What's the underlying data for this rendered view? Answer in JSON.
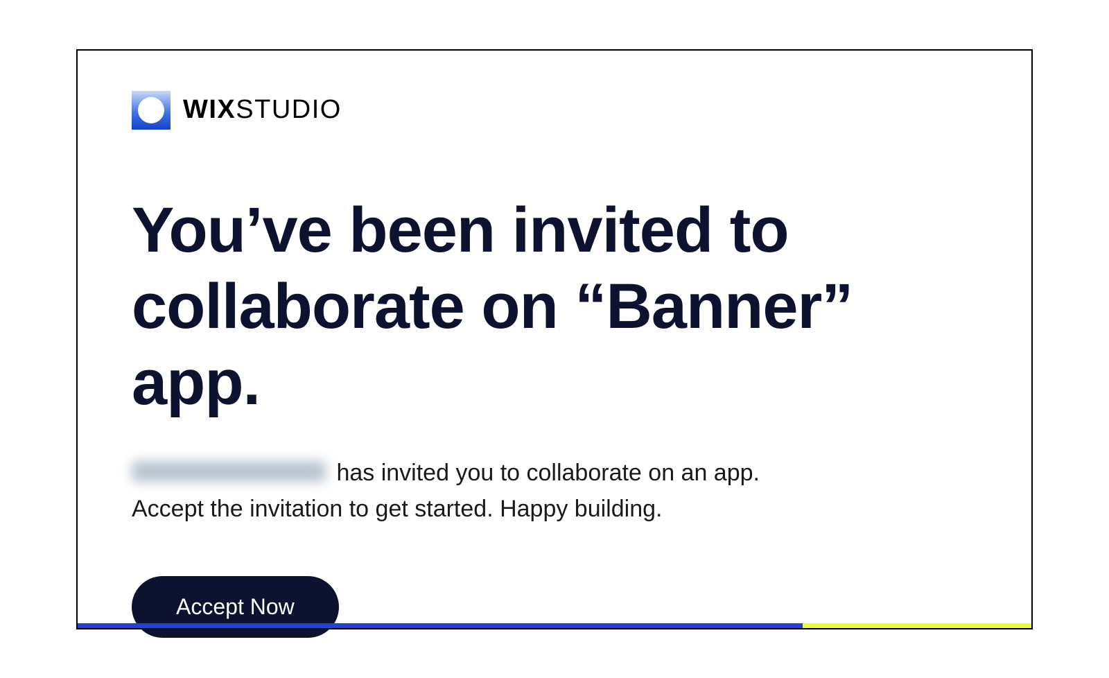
{
  "brand": {
    "bold": "WIX",
    "light": "STUDIO"
  },
  "headline": "You’ve been invited to collaborate on “Banner” app.",
  "body": {
    "line1_suffix": " has invited you to collaborate on an app.",
    "line2": "Accept the invitation to get started. Happy building."
  },
  "cta": {
    "label": "Accept Now"
  }
}
